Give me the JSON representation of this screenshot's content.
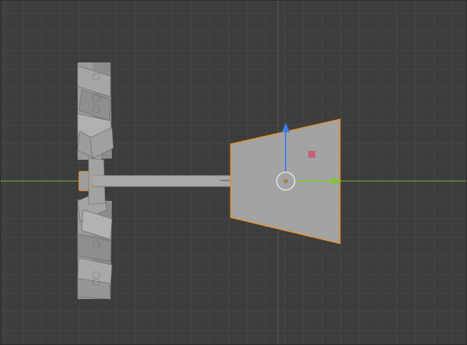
{
  "viewport": {
    "background": "#3d3d3d",
    "grid_color": "#474747",
    "x_axis_color": "#6ea82c",
    "y_axis_color": "#4d6a8c"
  },
  "object": {
    "fill": "#9e9e9e",
    "dark_fill": "#7a7a7a",
    "selection_outline": "#e8902f",
    "shaft_fill": "#a8a8a8"
  },
  "gizmo": {
    "x_arrow_color": "#7ec43a",
    "z_arrow_color": "#3b7ee6",
    "pivot_color": "#e8902f",
    "center_ring_color": "#e6e6e6",
    "plane_handle_color": "#cc5566"
  }
}
